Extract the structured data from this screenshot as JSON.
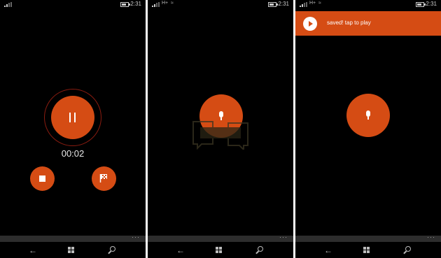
{
  "status_bar": {
    "network": "H+",
    "time": "2:31"
  },
  "screens": [
    {
      "timer": "00:02",
      "icons": [
        "pause-icon",
        "stop-icon",
        "flag-icon"
      ]
    },
    {
      "icons": [
        "mic-icon"
      ]
    },
    {
      "toast": "saved! tap to play",
      "icons": [
        "play-icon",
        "mic-icon"
      ]
    }
  ],
  "app_bar": {
    "more": "···"
  },
  "nav": {
    "icons": [
      "back-icon",
      "windows-icon",
      "search-icon"
    ]
  },
  "watermark": {
    "text": ""
  },
  "colors": {
    "accent": "#d54c14",
    "background": "#000000",
    "appbar": "#2d2d2d"
  }
}
